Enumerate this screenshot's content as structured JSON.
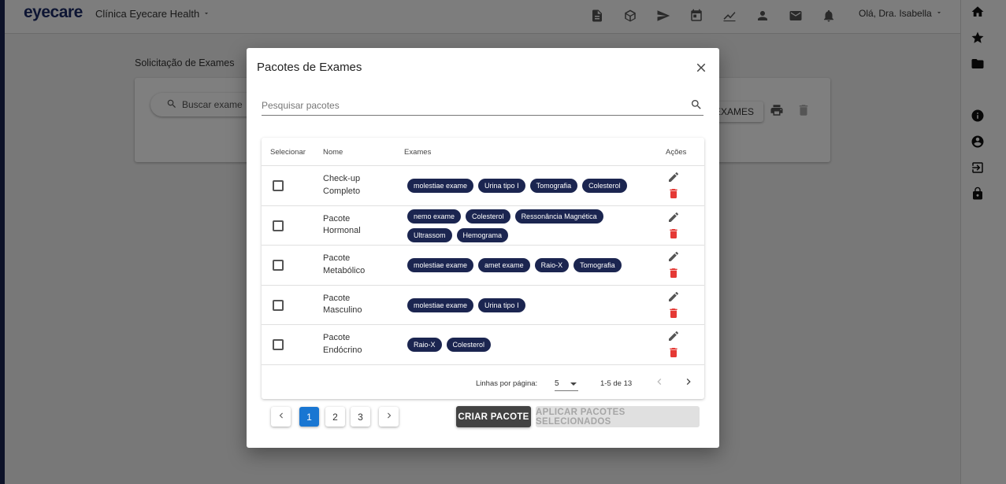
{
  "app": {
    "logo": "eyecare",
    "clinic_name": "Clínica Eyecare Health",
    "greeting": "Olá, Dra. Isabella",
    "page_title": "Solicitação de Exames",
    "search_placeholder": "Buscar exame",
    "exams_button_label": "EXAMES",
    "top_icons": [
      "document-icon",
      "cube-icon",
      "send-icon",
      "calendar-icon",
      "chart-icon",
      "person-icon",
      "mail-icon",
      "bell-icon"
    ],
    "rail_icons": [
      "home-icon",
      "star-icon",
      "folder-icon",
      "info-icon",
      "account-circle-icon",
      "logout-icon",
      "lock-icon"
    ]
  },
  "modal": {
    "title": "Pacotes de Exames",
    "search_placeholder": "Pesquisar pacotes",
    "columns": {
      "select": "Selecionar",
      "name": "Nome",
      "exams": "Exames",
      "actions": "Ações"
    },
    "rows": [
      {
        "name": "Check-up Completo",
        "exams": [
          "molestiae exame",
          "Urina tipo I",
          "Tomografia",
          "Colesterol"
        ]
      },
      {
        "name": "Pacote Hormonal",
        "exams": [
          "nemo exame",
          "Colesterol",
          "Ressonância Magnética",
          "Ultrassom",
          "Hemograma"
        ]
      },
      {
        "name": "Pacote Metabólico",
        "exams": [
          "molestiae exame",
          "amet exame",
          "Raio-X",
          "Tomografia"
        ]
      },
      {
        "name": "Pacote Masculino",
        "exams": [
          "molestiae exame",
          "Urina tipo I"
        ]
      },
      {
        "name": "Pacote Endócrino",
        "exams": [
          "Raio-X",
          "Colesterol"
        ]
      }
    ],
    "footer": {
      "rows_per_page_label": "Linhas por página:",
      "rows_per_page_value": "5",
      "range": "1-5 de 13"
    },
    "pages": [
      "1",
      "2",
      "3"
    ],
    "current_page": "1",
    "create_button": "CRIAR PACOTE",
    "apply_button": "APLICAR PACOTES SELECIONADOS"
  },
  "colors": {
    "chip": "#1b2550",
    "primary": "#1976d2",
    "delete": "#e53935",
    "create_button": "#424242"
  }
}
